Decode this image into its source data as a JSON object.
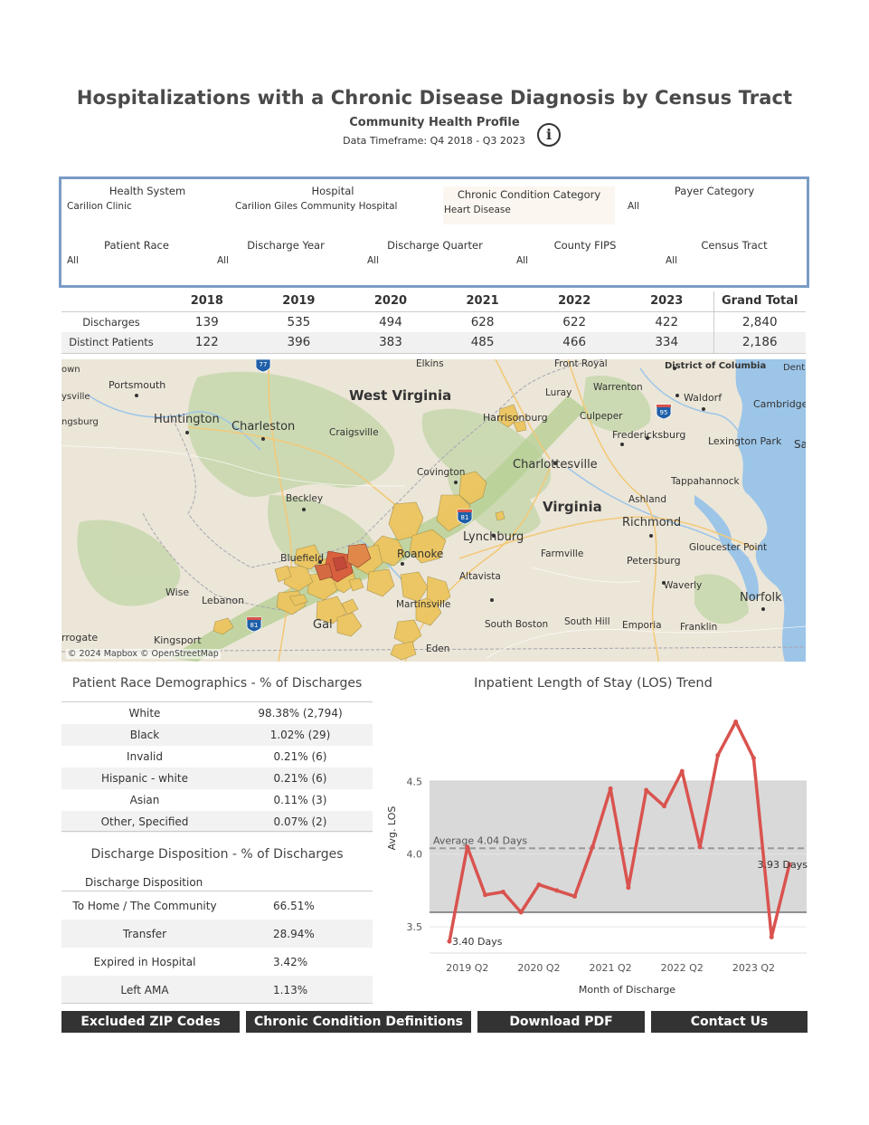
{
  "header": {
    "title": "Hospitalizations with a Chronic Disease Diagnosis by Census Tract",
    "subtitle": "Community Health Profile",
    "timeframe": "Data Timeframe: Q4 2018 - Q3 2023",
    "info_icon": "info-icon"
  },
  "filters": [
    {
      "label": "Health System",
      "value": "Carilion Clinic"
    },
    {
      "label": "Hospital",
      "value": "Carilion Giles Community Hospital"
    },
    {
      "label": "Chronic Condition Category",
      "value": "Heart Disease"
    },
    {
      "label": "Payer Category",
      "value": "All"
    },
    {
      "label": "Patient Race",
      "value": "All"
    },
    {
      "label": "Discharge Year",
      "value": "All"
    },
    {
      "label": "Discharge Quarter",
      "value": "All"
    },
    {
      "label": "County FIPS",
      "value": "All"
    },
    {
      "label": "Census Tract",
      "value": "All"
    }
  ],
  "summary": {
    "columns": [
      "2018",
      "2019",
      "2020",
      "2021",
      "2022",
      "2023",
      "Grand Total"
    ],
    "rows": [
      {
        "label": "Discharges",
        "values": [
          "139",
          "535",
          "494",
          "628",
          "622",
          "422",
          "2,840"
        ]
      },
      {
        "label": "Distinct Patients",
        "values": [
          "122",
          "396",
          "383",
          "485",
          "466",
          "334",
          "2,186"
        ]
      }
    ]
  },
  "map": {
    "attribution": "© 2024 Mapbox © OpenStreetMap",
    "labels": {
      "west_virginia": "West Virginia",
      "virginia": "Virginia",
      "huntington": "Huntington",
      "charleston": "Charleston",
      "portsmouth": "Portsmouth",
      "craigsville": "Craigsville",
      "beckley": "Beckley",
      "bluefield": "Bluefield",
      "wise": "Wise",
      "lebanon": "Lebanon",
      "kingsport": "Kingsport",
      "harrisonburg": "Harrisonburg",
      "charlottesville": "Charlottesville",
      "lynchburg": "Lynchburg",
      "roanoke": "Roanoke",
      "covington": "Covington",
      "altavista": "Altavista",
      "farmville": "Farmville",
      "richmond": "Richmond",
      "petersburg": "Petersburg",
      "norfolk": "Norfolk",
      "ashland": "Ashland",
      "fredericksburg": "Fredericksburg",
      "culpeper": "Culpeper",
      "luray": "Luray",
      "warrenton": "Warrenton",
      "front_royal": "Front Royal",
      "elkins": "Elkins",
      "dc": "District of Columbia",
      "waldorf": "Waldorf",
      "cambridge": "Cambridge",
      "lexington_park": "Lexington Park",
      "tappahannock": "Tappahannock",
      "gloucester_point": "Gloucester Point",
      "waverly": "Waverly",
      "emporia": "Emporia",
      "franklin": "Franklin",
      "south_boston": "South Boston",
      "south_hill": "South Hill",
      "martinsville": "Martinsville",
      "eden": "Eden",
      "galax": "Gal",
      "rrogate": "rrogate",
      "ysville": "ysville",
      "ngsburg": "ngsburg",
      "own": "own",
      "dent": "Dent",
      "sa": "Sa",
      "i77": "77",
      "i81a": "81",
      "i81b": "81",
      "i95": "95"
    }
  },
  "race": {
    "title": "Patient Race Demographics - % of Discharges",
    "rows": [
      {
        "race": "White",
        "value": "98.38% (2,794)"
      },
      {
        "race": "Black",
        "value": "1.02% (29)"
      },
      {
        "race": "Invalid",
        "value": "0.21% (6)"
      },
      {
        "race": "Hispanic - white",
        "value": "0.21% (6)"
      },
      {
        "race": "Asian",
        "value": "0.11% (3)"
      },
      {
        "race": "Other, Specified",
        "value": "0.07% (2)"
      }
    ]
  },
  "disposition": {
    "title": "Discharge Disposition - % of Discharges",
    "header": "Discharge Disposition",
    "rows": [
      {
        "label": "To Home / The Community",
        "value": "66.51%"
      },
      {
        "label": "Transfer",
        "value": "28.94%"
      },
      {
        "label": "Expired in Hospital",
        "value": "3.42%"
      },
      {
        "label": "Left AMA",
        "value": "1.13%"
      }
    ]
  },
  "chart_data": {
    "type": "line",
    "title": "Inpatient Length of Stay (LOS) Trend",
    "xlabel": "Month of Discharge",
    "ylabel": "Avg. LOS",
    "ylim": [
      3.32,
      5.05
    ],
    "yticks": [
      "3.5",
      "4.0",
      "4.5"
    ],
    "x_tick_labels": [
      "2019 Q2",
      "2020 Q2",
      "2021 Q2",
      "2022 Q2",
      "2023 Q2"
    ],
    "series": [
      {
        "values": [
          3.4,
          4.05,
          3.72,
          3.74,
          3.6,
          3.79,
          3.75,
          3.71,
          4.05,
          4.45,
          3.77,
          4.44,
          4.33,
          4.57,
          4.05,
          4.68,
          4.91,
          4.66,
          3.43,
          3.93
        ],
        "color": "#d9534f"
      }
    ],
    "average": 4.04,
    "average_label": "Average 4.04 Days",
    "first_label": "3.40 Days",
    "last_label": "3.93 Days",
    "band": [
      3.6,
      4.5
    ],
    "band_color": "#d9d9d9",
    "grid": true
  },
  "buttons": [
    {
      "label": "Excluded ZIP Codes"
    },
    {
      "label": "Chronic Condition Definitions"
    },
    {
      "label": "Download PDF"
    },
    {
      "label": "Contact Us"
    }
  ]
}
